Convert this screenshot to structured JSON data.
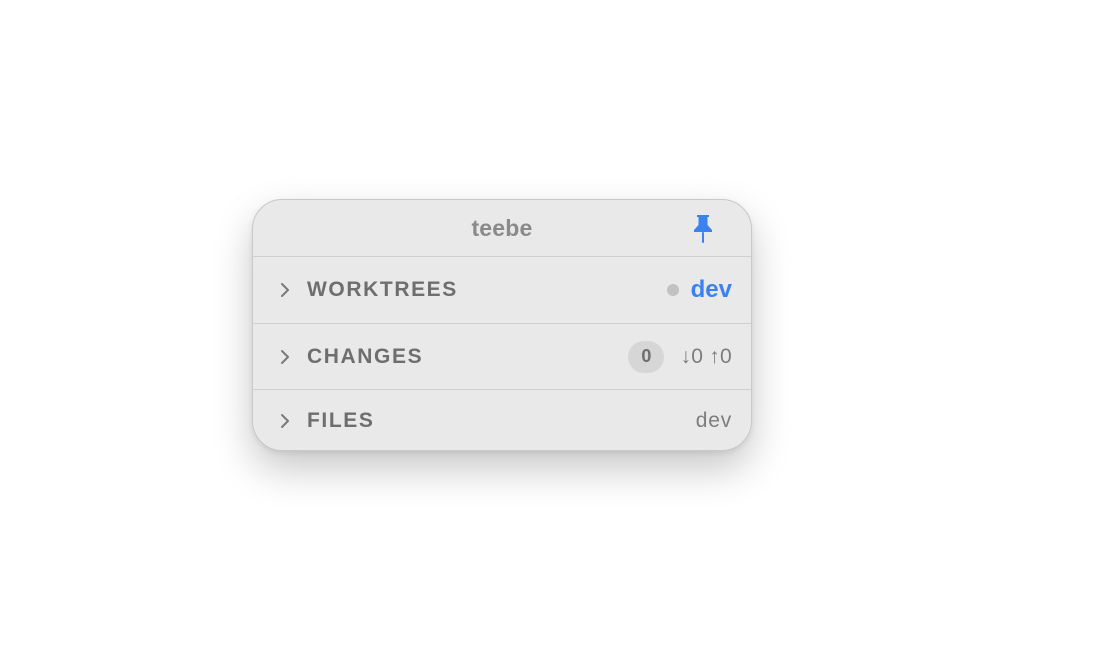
{
  "window": {
    "title": "teebe"
  },
  "colors": {
    "accent": "#3a82f0",
    "panel_bg": "#e9e9e9",
    "label": "#6e6e6e"
  },
  "sections": {
    "worktrees": {
      "label": "WORKTREES",
      "branch": "dev"
    },
    "changes": {
      "label": "CHANGES",
      "count": "0",
      "incoming": "↓0",
      "outgoing": "↑0"
    },
    "files": {
      "label": "FILES",
      "branch": "dev"
    }
  },
  "icons": {
    "pin": "pin-icon",
    "chevron": "chevron-right-icon",
    "status": "status-dot-icon"
  }
}
